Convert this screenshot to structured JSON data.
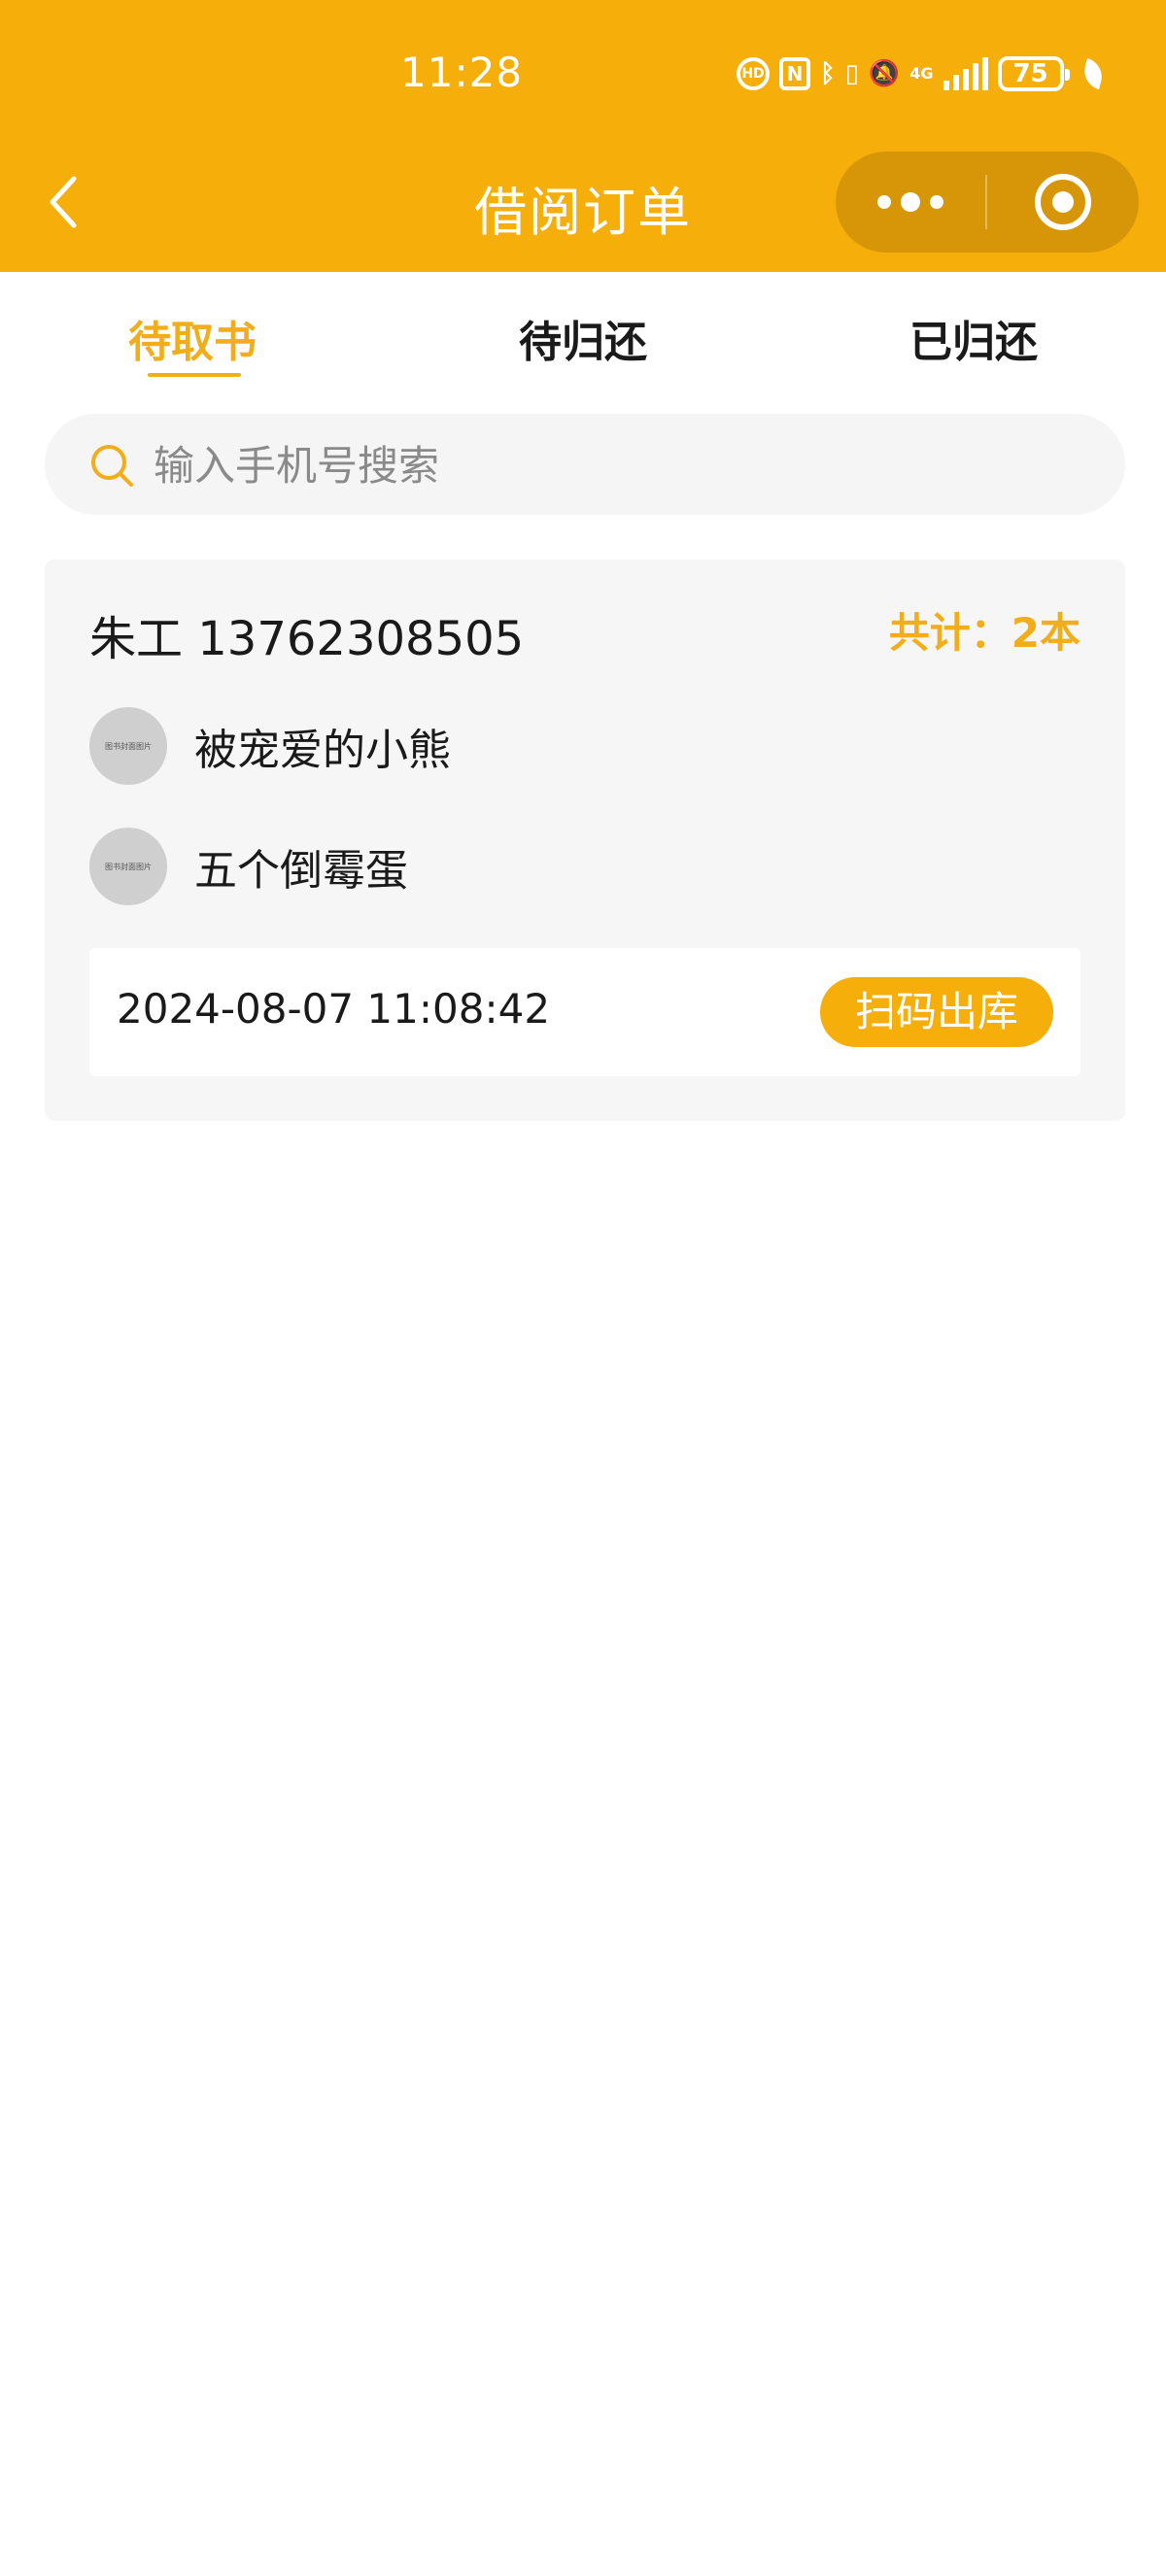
{
  "status_bar": {
    "time": "11:28",
    "icons": [
      "hd-call-icon",
      "nfc-icon",
      "bluetooth-icon",
      "vibrate-icon",
      "mute-bell-icon",
      "4g-signal-icon",
      "battery-icon",
      "eco-leaf-icon"
    ],
    "nfc_label": "N",
    "hd_label": "HD",
    "network_label": "4G",
    "battery_level": "75"
  },
  "header": {
    "title": "借阅订单",
    "background_color": "#f6ae0b"
  },
  "tabs": [
    {
      "label": "待取书",
      "active": true
    },
    {
      "label": "待归还",
      "active": false
    },
    {
      "label": "已归还",
      "active": false
    }
  ],
  "search": {
    "placeholder": "输入手机号搜索",
    "value": ""
  },
  "orders": [
    {
      "customer": "朱工 13762308505",
      "total": "共计：2本",
      "books": [
        {
          "title": "被宠爱的小熊",
          "thumb_label": "图书封面图片"
        },
        {
          "title": "五个倒霉蛋",
          "thumb_label": "图书封面图片"
        }
      ],
      "time": "2024-08-07 11:08:42",
      "action_label": "扫码出库"
    }
  ],
  "colors": {
    "accent": "#f2ad1b",
    "card_bg": "#f6f6f6"
  }
}
